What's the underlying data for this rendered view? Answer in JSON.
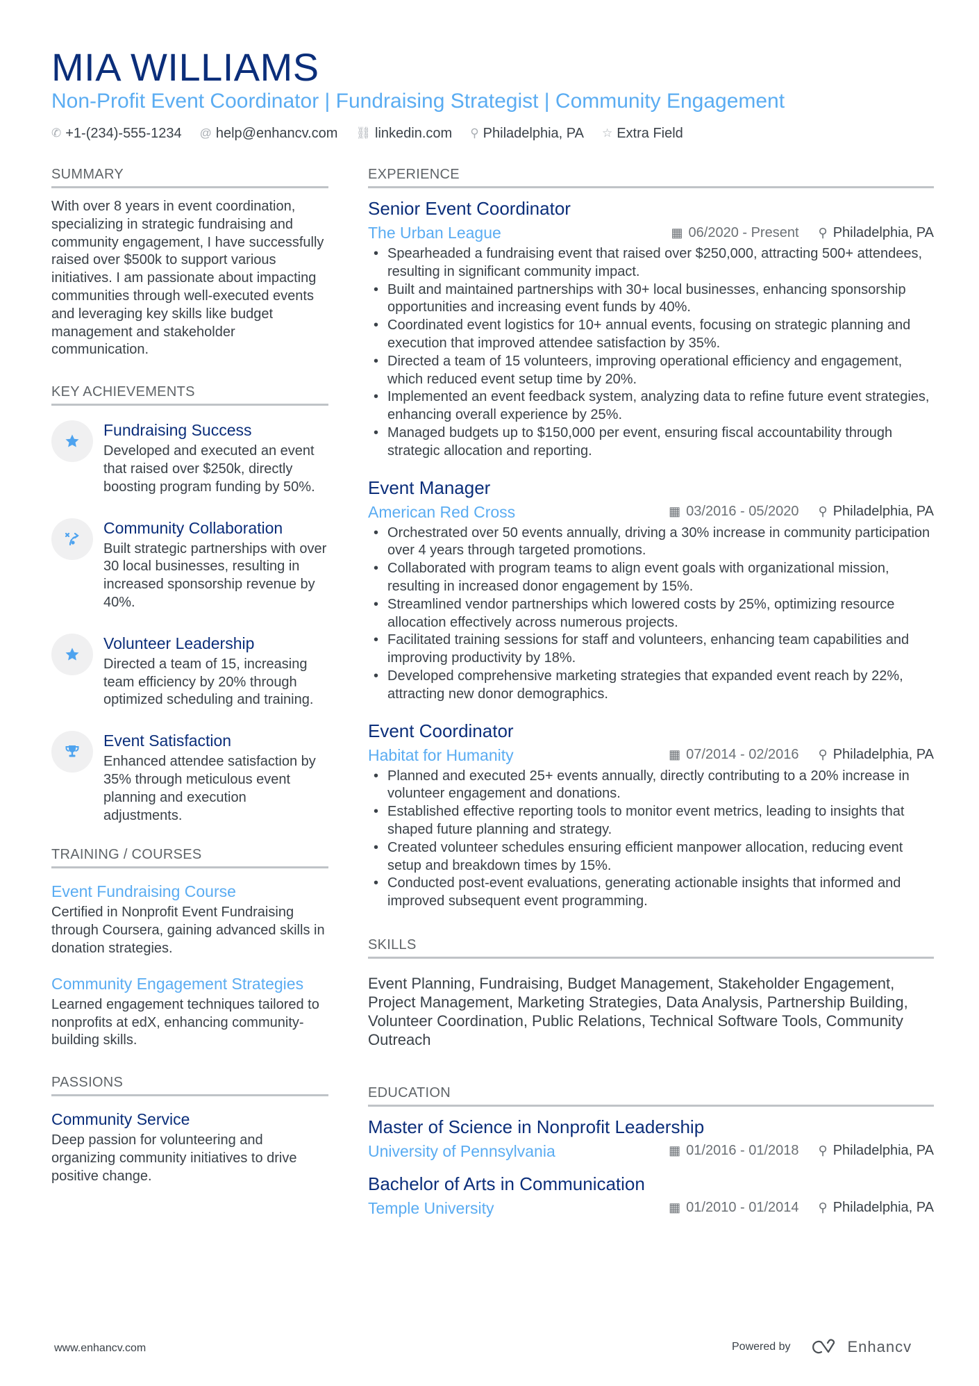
{
  "header": {
    "name": "MIA WILLIAMS",
    "headline": "Non-Profit Event Coordinator | Fundraising Strategist | Community Engagement",
    "contacts": [
      {
        "icon": "phone-icon",
        "glyph": "✆",
        "text": "+1-(234)-555-1234"
      },
      {
        "icon": "at-icon",
        "glyph": "@",
        "text": "help@enhancv.com"
      },
      {
        "icon": "link-icon",
        "glyph": "⛓",
        "text": "linkedin.com"
      },
      {
        "icon": "location-pin-icon",
        "glyph": "⚲",
        "text": "Philadelphia, PA"
      },
      {
        "icon": "star-outline-icon",
        "glyph": "☆",
        "text": "Extra Field"
      }
    ]
  },
  "summary": {
    "heading": "SUMMARY",
    "text": "With over 8 years in event coordination, specializing in strategic fundraising and community engagement, I have successfully raised over $500k to support various initiatives. I am passionate about impacting communities through well-executed events and leveraging key skills like budget management and stakeholder communication."
  },
  "achievements": {
    "heading": "KEY ACHIEVEMENTS",
    "items": [
      {
        "icon": "star-icon",
        "glyph": "★",
        "title": "Fundraising Success",
        "text": "Developed and executed an event that raised over $250k, directly boosting program funding by 50%."
      },
      {
        "icon": "strategy-icon",
        "glyph": "⤴",
        "title": "Community Collaboration",
        "text": "Built strategic partnerships with over 30 local businesses, resulting in increased sponsorship revenue by 40%."
      },
      {
        "icon": "star-icon",
        "glyph": "★",
        "title": "Volunteer Leadership",
        "text": "Directed a team of 15, increasing team efficiency by 20% through optimized scheduling and training."
      },
      {
        "icon": "trophy-icon",
        "glyph": "🏆",
        "title": "Event Satisfaction",
        "text": "Enhanced attendee satisfaction by 35% through meticulous event planning and execution adjustments."
      }
    ]
  },
  "training": {
    "heading": "TRAINING / COURSES",
    "items": [
      {
        "title": "Event Fundraising Course",
        "text": "Certified in Nonprofit Event Fundraising through Coursera, gaining advanced skills in donation strategies."
      },
      {
        "title": "Community Engagement Strategies",
        "text": "Learned engagement techniques tailored to nonprofits at edX, enhancing community-building skills."
      }
    ]
  },
  "passions": {
    "heading": "PASSIONS",
    "items": [
      {
        "title": "Community Service",
        "text": "Deep passion for volunteering and organizing community initiatives to drive positive change."
      }
    ]
  },
  "experience": {
    "heading": "EXPERIENCE",
    "jobs": [
      {
        "title": "Senior Event Coordinator",
        "org": "The Urban League",
        "dates": "06/2020 - Present",
        "location": "Philadelphia, PA",
        "bullets": [
          "Spearheaded a fundraising event that raised over $250,000, attracting 500+ attendees, resulting in significant community impact.",
          "Built and maintained partnerships with 30+ local businesses, enhancing sponsorship opportunities and increasing event funds by 40%.",
          "Coordinated event logistics for 10+ annual events, focusing on strategic planning and execution that improved attendee satisfaction by 35%.",
          "Directed a team of 15 volunteers, improving operational efficiency and engagement, which reduced event setup time by 20%.",
          "Implemented an event feedback system, analyzing data to refine future event strategies, enhancing overall experience by 25%.",
          "Managed budgets up to $150,000 per event, ensuring fiscal accountability through strategic allocation and reporting."
        ]
      },
      {
        "title": "Event Manager",
        "org": "American Red Cross",
        "dates": "03/2016 - 05/2020",
        "location": "Philadelphia, PA",
        "bullets": [
          "Orchestrated over 50 events annually, driving a 30% increase in community participation over 4 years through targeted promotions.",
          "Collaborated with program teams to align event goals with organizational mission, resulting in increased donor engagement by 15%.",
          "Streamlined vendor partnerships which lowered costs by 25%, optimizing resource allocation effectively across numerous projects.",
          "Facilitated training sessions for staff and volunteers, enhancing team capabilities and improving productivity by 18%.",
          "Developed comprehensive marketing strategies that expanded event reach by 22%, attracting new donor demographics."
        ]
      },
      {
        "title": "Event Coordinator",
        "org": "Habitat for Humanity",
        "dates": "07/2014 - 02/2016",
        "location": "Philadelphia, PA",
        "bullets": [
          "Planned and executed 25+ events annually, directly contributing to a 20% increase in volunteer engagement and donations.",
          "Established effective reporting tools to monitor event metrics, leading to insights that shaped future planning and strategy.",
          "Created volunteer schedules ensuring efficient manpower allocation, reducing event setup and breakdown times by 15%.",
          "Conducted post-event evaluations, generating actionable insights that informed and improved subsequent event programming."
        ]
      }
    ]
  },
  "skills": {
    "heading": "SKILLS",
    "text": "Event Planning, Fundraising, Budget Management, Stakeholder Engagement, Project Management, Marketing Strategies, Data Analysis, Partnership Building, Volunteer Coordination, Public Relations, Technical Software Tools, Community Outreach"
  },
  "education": {
    "heading": "EDUCATION",
    "items": [
      {
        "degree": "Master of Science in Nonprofit Leadership",
        "school": "University of Pennsylvania",
        "dates": "01/2016 - 01/2018",
        "location": "Philadelphia, PA"
      },
      {
        "degree": "Bachelor of Arts in Communication",
        "school": "Temple University",
        "dates": "01/2010 - 01/2014",
        "location": "Philadelphia, PA"
      }
    ]
  },
  "footer": {
    "website": "www.enhancv.com",
    "powered_by": "Powered by",
    "brand": "Enhancv"
  },
  "icons": {
    "calendar": "▦",
    "pin": "⚲"
  },
  "colors": {
    "name": "#0b2e7a",
    "accent": "#5aacf2",
    "text": "#3a4148",
    "rule": "#bfc3c7"
  }
}
